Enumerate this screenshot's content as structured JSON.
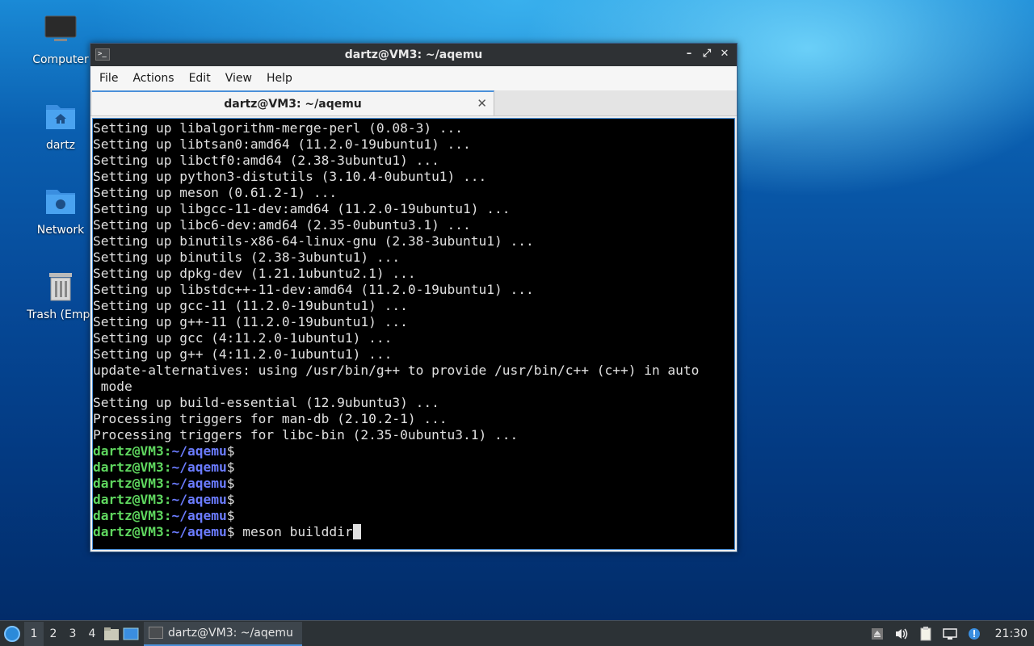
{
  "desktop": {
    "icons": [
      {
        "label": "Computer"
      },
      {
        "label": "dartz"
      },
      {
        "label": "Network"
      },
      {
        "label": "Trash (Empt"
      }
    ]
  },
  "window": {
    "title": "dartz@VM3: ~/aqemu",
    "menu": [
      "File",
      "Actions",
      "Edit",
      "View",
      "Help"
    ],
    "tab_title": "dartz@VM3: ~/aqemu"
  },
  "terminal": {
    "output_lines": [
      "Setting up libalgorithm-merge-perl (0.08-3) ...",
      "Setting up libtsan0:amd64 (11.2.0-19ubuntu1) ...",
      "Setting up libctf0:amd64 (2.38-3ubuntu1) ...",
      "Setting up python3-distutils (3.10.4-0ubuntu1) ...",
      "Setting up meson (0.61.2-1) ...",
      "Setting up libgcc-11-dev:amd64 (11.2.0-19ubuntu1) ...",
      "Setting up libc6-dev:amd64 (2.35-0ubuntu3.1) ...",
      "Setting up binutils-x86-64-linux-gnu (2.38-3ubuntu1) ...",
      "Setting up binutils (2.38-3ubuntu1) ...",
      "Setting up dpkg-dev (1.21.1ubuntu2.1) ...",
      "Setting up libstdc++-11-dev:amd64 (11.2.0-19ubuntu1) ...",
      "Setting up gcc-11 (11.2.0-19ubuntu1) ...",
      "Setting up g++-11 (11.2.0-19ubuntu1) ...",
      "Setting up gcc (4:11.2.0-1ubuntu1) ...",
      "Setting up g++ (4:11.2.0-1ubuntu1) ...",
      "update-alternatives: using /usr/bin/g++ to provide /usr/bin/c++ (c++) in auto",
      " mode",
      "Setting up build-essential (12.9ubuntu3) ...",
      "Processing triggers for man-db (2.10.2-1) ...",
      "Processing triggers for libc-bin (2.35-0ubuntu3.1) ..."
    ],
    "prompt_user": "dartz@VM3",
    "prompt_sep": ":",
    "prompt_path": "~/aqemu",
    "prompt_end": "$",
    "empty_prompts": 5,
    "current_command": " meson builddir"
  },
  "taskbar": {
    "workspaces": [
      "1",
      "2",
      "3",
      "4"
    ],
    "active_workspace": "1",
    "task_label": "dartz@VM3: ~/aqemu",
    "clock": "21:30"
  }
}
